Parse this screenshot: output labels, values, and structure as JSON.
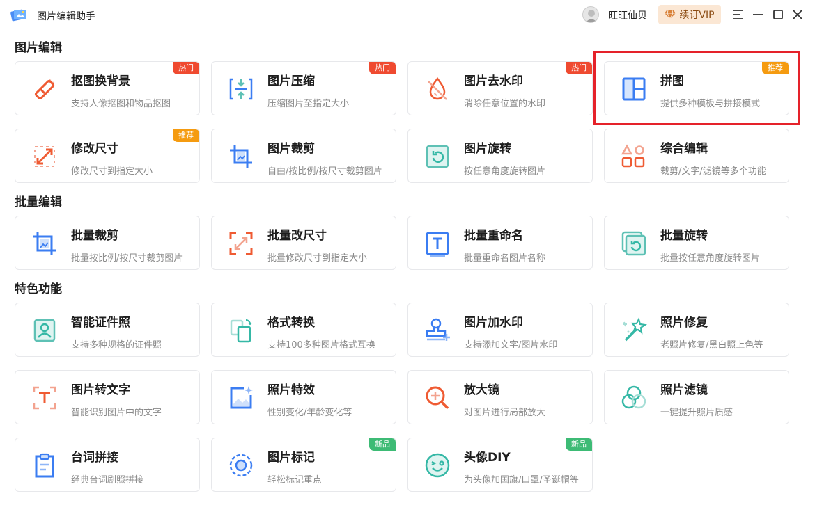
{
  "app": {
    "title": "图片编辑助手",
    "user_name": "旺旺仙贝",
    "vip_label": "续订VIP"
  },
  "colors": {
    "accent_blue": "#3b7df2",
    "accent_orange": "#ef5b33",
    "accent_teal": "#35b8a6",
    "highlight_red": "#e5222a"
  },
  "sections": [
    {
      "title": "图片编辑"
    },
    {
      "title": "批量编辑"
    },
    {
      "title": "特色功能"
    }
  ],
  "cards": [
    {
      "title": "抠图换背景",
      "desc": "支持人像抠图和物品抠图",
      "badge": "热门",
      "icon": "eraser-icon"
    },
    {
      "title": "图片压缩",
      "desc": "压缩图片至指定大小",
      "badge": "热门",
      "icon": "compress-icon"
    },
    {
      "title": "图片去水印",
      "desc": "消除任意位置的水印",
      "badge": "热门",
      "icon": "drop-slash-icon"
    },
    {
      "title": "拼图",
      "desc": "提供多种模板与拼接模式",
      "badge": "推荐",
      "icon": "collage-icon"
    },
    {
      "title": "修改尺寸",
      "desc": "修改尺寸到指定大小",
      "badge": "推荐",
      "icon": "resize-icon"
    },
    {
      "title": "图片裁剪",
      "desc": "自由/按比例/按尺寸裁剪图片",
      "badge": "",
      "icon": "crop-icon"
    },
    {
      "title": "图片旋转",
      "desc": "按任意角度旋转图片",
      "badge": "",
      "icon": "rotate-icon"
    },
    {
      "title": "综合编辑",
      "desc": "裁剪/文字/滤镜等多个功能",
      "badge": "",
      "icon": "shapes-icon"
    },
    {
      "title": "批量裁剪",
      "desc": "批量按比例/按尺寸裁剪图片",
      "badge": "",
      "icon": "batch-crop-icon"
    },
    {
      "title": "批量改尺寸",
      "desc": "批量修改尺寸到指定大小",
      "badge": "",
      "icon": "batch-resize-icon"
    },
    {
      "title": "批量重命名",
      "desc": "批量重命名图片名称",
      "badge": "",
      "icon": "rename-icon"
    },
    {
      "title": "批量旋转",
      "desc": "批量按任意角度旋转图片",
      "badge": "",
      "icon": "batch-rotate-icon"
    },
    {
      "title": "智能证件照",
      "desc": "支持多种规格的证件照",
      "badge": "",
      "icon": "id-photo-icon"
    },
    {
      "title": "格式转换",
      "desc": "支持100多种图片格式互换",
      "badge": "",
      "icon": "convert-icon"
    },
    {
      "title": "图片加水印",
      "desc": "支持添加文字/图片水印",
      "badge": "",
      "icon": "stamp-icon"
    },
    {
      "title": "照片修复",
      "desc": "老照片修复/黑白照上色等",
      "badge": "",
      "icon": "magic-wand-icon"
    },
    {
      "title": "图片转文字",
      "desc": "智能识别图片中的文字",
      "badge": "",
      "icon": "ocr-icon"
    },
    {
      "title": "照片特效",
      "desc": "性别变化/年龄变化等",
      "badge": "",
      "icon": "effect-icon"
    },
    {
      "title": "放大镜",
      "desc": "对图片进行局部放大",
      "badge": "",
      "icon": "magnifier-icon"
    },
    {
      "title": "照片滤镜",
      "desc": "一键提升照片质感",
      "badge": "",
      "icon": "filter-icon"
    },
    {
      "title": "台词拼接",
      "desc": "经典台词剧照拼接",
      "badge": "",
      "icon": "clipboard-icon"
    },
    {
      "title": "图片标记",
      "desc": "轻松标记重点",
      "badge": "新品",
      "icon": "marker-icon"
    },
    {
      "title": "头像DIY",
      "desc": "为头像加国旗/口罩/圣诞帽等",
      "badge": "新品",
      "icon": "smile-icon"
    }
  ]
}
